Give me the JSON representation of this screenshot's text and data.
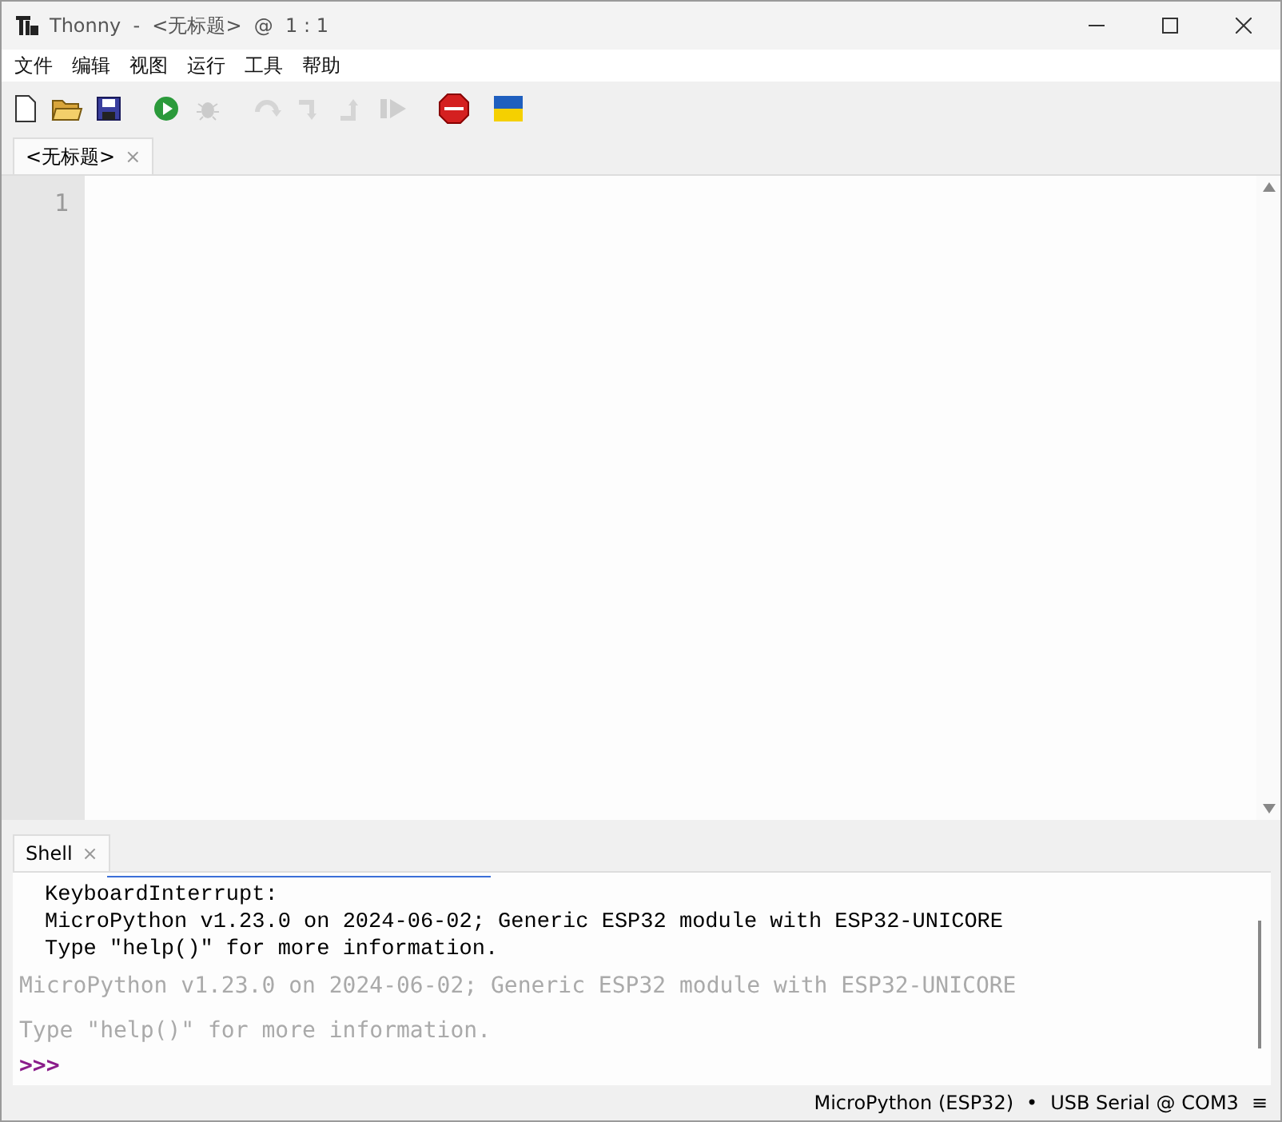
{
  "window": {
    "title": "Thonny  -  <无标题>  @  1 : 1"
  },
  "menu": [
    "文件",
    "编辑",
    "视图",
    "运行",
    "工具",
    "帮助"
  ],
  "toolbar": [
    {
      "kind": "new",
      "disabled": false
    },
    {
      "kind": "open",
      "disabled": false
    },
    {
      "kind": "save",
      "disabled": false
    },
    {
      "kind": "run",
      "disabled": false
    },
    {
      "kind": "debug",
      "disabled": true
    },
    {
      "kind": "step-over",
      "disabled": true
    },
    {
      "kind": "step-into",
      "disabled": true
    },
    {
      "kind": "step-out",
      "disabled": true
    },
    {
      "kind": "resume",
      "disabled": true
    },
    {
      "kind": "stop",
      "disabled": false
    },
    {
      "kind": "flag",
      "disabled": false
    }
  ],
  "editor_tabs": [
    {
      "label": "<无标题>",
      "selected": true,
      "close": "×"
    }
  ],
  "editor": {
    "line_numbers": [
      "1"
    ]
  },
  "shell_tabs": [
    {
      "label": "Shell",
      "selected": true,
      "close": "×"
    }
  ],
  "shell": {
    "lines": [
      {
        "kind": "output",
        "text": "KeyboardInterrupt:"
      },
      {
        "kind": "output",
        "text": "MicroPython v1.23.0 on 2024-06-02; Generic ESP32 module with ESP32-UNICORE"
      },
      {
        "kind": "output",
        "text": "Type \"help()\" for more information."
      },
      {
        "kind": "banner",
        "text": "MicroPython v1.23.0 on 2024-06-02; Generic ESP32 module with ESP32-UNICORE"
      },
      {
        "kind": "banner",
        "text": "Type \"help()\" for more information."
      },
      {
        "kind": "prompt",
        "text": ">>>"
      }
    ]
  },
  "status_bar": {
    "interpreter": "MicroPython (ESP32)",
    "separator": "•",
    "port": "USB Serial @ COM3",
    "menu": "≡"
  }
}
